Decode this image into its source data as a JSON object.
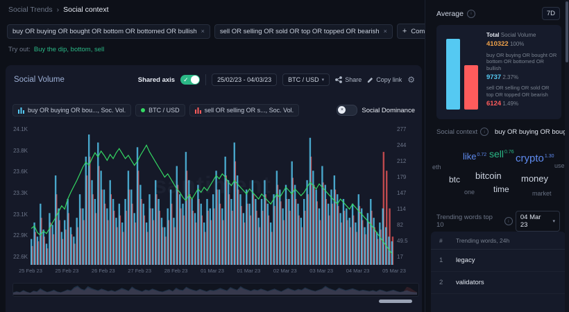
{
  "icons": {
    "info": "i",
    "close": "×",
    "check": "✓",
    "gear": "⚙",
    "chevron_down": "▾",
    "plus": "+"
  },
  "breadcrumb": {
    "parent": "Social Trends",
    "sep": "›",
    "current": "Social context"
  },
  "filters": {
    "chips": [
      {
        "label": "buy OR buying OR bought OR bottom OR bottomed OR bullish"
      },
      {
        "label": "sell OR selling OR sold OR top OR topped OR bearish"
      }
    ],
    "compare": "Compare",
    "try_out_prefix": "Try out:",
    "try_out_suggestions": "Buy the dip, bottom, sell"
  },
  "chart_panel": {
    "title": "Social Volume",
    "shared_axis": "Shared axis",
    "date_range": "25/02/23 - 04/03/23",
    "pair": "BTC / USD",
    "share": "Share",
    "copy_link": "Copy link",
    "social_dominance": "Social Dominance",
    "watermark": "santiment",
    "legend": [
      {
        "label": "buy OR buying OR bou..., Soc. Vol.",
        "color": "#55c9f2"
      },
      {
        "label": "BTC / USD",
        "color": "#34d863"
      },
      {
        "label": "sell OR selling OR s..., Soc. Vol.",
        "color": "#ff5c5c"
      }
    ]
  },
  "chart_data": {
    "type": "mixed",
    "title": "Social Volume",
    "x_labels": [
      "25 Feb 23",
      "25 Feb 23",
      "26 Feb 23",
      "27 Feb 23",
      "28 Feb 23",
      "01 Mar 23",
      "01 Mar 23",
      "02 Mar 23",
      "03 Mar 23",
      "04 Mar 23",
      "05 Mar 23"
    ],
    "left_axis": {
      "min": 22600,
      "max": 24100,
      "tick_labels": [
        "24.1K",
        "23.8K",
        "23.6K",
        "23.3K",
        "23.1K",
        "22.9K",
        "22.6K"
      ]
    },
    "right_axis": {
      "min": 0,
      "max": 277,
      "tick_labels": [
        "277",
        "244",
        "212",
        "179",
        "147",
        "114",
        "82",
        "49.5",
        "17"
      ]
    },
    "series": [
      {
        "name": "buy OR buying OR bought OR bottom OR bottomed OR bullish, Soc. Vol.",
        "type": "bar",
        "axis": "right",
        "color": "#55c9f2",
        "values": [
          55,
          90,
          60,
          130,
          75,
          45,
          110,
          85,
          190,
          120,
          70,
          95,
          140,
          80,
          60,
          100,
          150,
          120,
          230,
          277,
          180,
          140,
          260,
          200,
          160,
          120,
          180,
          140,
          100,
          130,
          90,
          140,
          200,
          160,
          110,
          250,
          170,
          130,
          90,
          150,
          120,
          180,
          140,
          100,
          80,
          120,
          160,
          100,
          210,
          150,
          130,
          240,
          180,
          140,
          110,
          170,
          130,
          90,
          140,
          120,
          150,
          200,
          160,
          120,
          230,
          180,
          140,
          260,
          190,
          150,
          110,
          160,
          130,
          180,
          140,
          100,
          140,
          180,
          130,
          90,
          150,
          200,
          160,
          120,
          170,
          140,
          220,
          170,
          130,
          100,
          140,
          180,
          270,
          200,
          160,
          120,
          210,
          170,
          130,
          160,
          190,
          150,
          110,
          140,
          120,
          100,
          130,
          90,
          150,
          120,
          80,
          110,
          140,
          100,
          70,
          90,
          120,
          80,
          60,
          50
        ]
      },
      {
        "name": "sell OR selling OR sold OR top OR topped OR bearish, Soc. Vol.",
        "type": "bar",
        "axis": "right",
        "color": "#ff5c5c",
        "values": [
          40,
          70,
          50,
          100,
          60,
          35,
          90,
          65,
          150,
          95,
          55,
          75,
          110,
          65,
          45,
          80,
          120,
          95,
          190,
          230,
          150,
          110,
          210,
          160,
          130,
          95,
          150,
          115,
          80,
          105,
          70,
          115,
          160,
          130,
          90,
          200,
          140,
          105,
          70,
          120,
          95,
          150,
          115,
          80,
          60,
          95,
          130,
          80,
          170,
          120,
          105,
          200,
          150,
          115,
          90,
          140,
          105,
          70,
          115,
          95,
          120,
          160,
          130,
          95,
          190,
          150,
          115,
          220,
          160,
          125,
          90,
          130,
          105,
          150,
          115,
          80,
          115,
          150,
          105,
          70,
          125,
          170,
          135,
          95,
          140,
          115,
          185,
          140,
          105,
          80,
          115,
          150,
          230,
          170,
          135,
          95,
          175,
          140,
          105,
          130,
          160,
          125,
          90,
          115,
          95,
          80,
          105,
          70,
          125,
          95,
          65,
          90,
          115,
          80,
          55,
          75,
          240,
          200,
          120,
          60
        ]
      },
      {
        "name": "BTC / USD",
        "type": "line",
        "axis": "left",
        "color": "#34d863",
        "values": [
          22950,
          22980,
          22900,
          22870,
          22920,
          22890,
          22950,
          23020,
          23080,
          23150,
          23220,
          23180,
          23300,
          23380,
          23450,
          23520,
          23600,
          23680,
          23740,
          23700,
          23780,
          23850,
          23800,
          23870,
          23820,
          23760,
          23830,
          23780,
          23850,
          23900,
          23840,
          23780,
          23820,
          23760,
          23700,
          23750,
          23820,
          23880,
          23940,
          23860,
          23800,
          23740,
          23680,
          23620,
          23560,
          23600,
          23540,
          23480,
          23420,
          23380,
          23320,
          23280,
          23350,
          23300,
          23360,
          23420,
          23380,
          23440,
          23400,
          23460,
          23520,
          23580,
          23540,
          23600,
          23560,
          23500,
          23460,
          23520,
          23480,
          23440,
          23400,
          23360,
          23420,
          23380,
          23340,
          23300,
          23360,
          23320,
          23280,
          23240,
          23300,
          23360,
          23320,
          23380,
          23440,
          23400,
          23360,
          23420,
          23380,
          23340,
          23380,
          23440,
          23500,
          23460,
          23420,
          23480,
          23440,
          23400,
          23360,
          23320,
          23280,
          23240,
          23300,
          23260,
          23220,
          23180,
          23240,
          23200,
          23160,
          23120,
          23080,
          23040,
          23000,
          22950,
          22900,
          22850,
          22800,
          22750,
          22700,
          22650
        ]
      }
    ]
  },
  "sidebar": {
    "average_label": "Average",
    "period": "7D",
    "summary": {
      "total_strong": "Total",
      "total_rest": "Social Volume",
      "total_value": "410322",
      "total_pct": "100%",
      "buy_query": "buy OR buying OR bought OR bottom OR bottomed OR bullish",
      "buy_value": "9737",
      "buy_pct": "2.37%",
      "sell_query": "sell OR selling OR sold OR top OR topped OR bearish",
      "sell_value": "6124",
      "sell_pct": "1.49%"
    },
    "social_context_label": "Social context",
    "social_context_selected": "buy OR buying OR bough",
    "word_cloud": [
      {
        "text": "like",
        "score": "0.72",
        "tone": "blue",
        "size": 13
      },
      {
        "text": "sell",
        "score": "0.76",
        "tone": "green",
        "size": 14
      },
      {
        "text": "crypto",
        "score": "1.30",
        "tone": "blue",
        "size": 15
      },
      {
        "text": "eth",
        "tone": "dim",
        "size": 9
      },
      {
        "text": "use",
        "tone": "dim",
        "size": 9
      },
      {
        "text": "btc",
        "tone": "light",
        "size": 12
      },
      {
        "text": "bitcoin",
        "tone": "light",
        "size": 13
      },
      {
        "text": "money",
        "tone": "light",
        "size": 13
      },
      {
        "text": "one",
        "tone": "dim",
        "size": 9
      },
      {
        "text": "time",
        "tone": "light",
        "size": 12
      },
      {
        "text": "market",
        "tone": "dim",
        "size": 9
      }
    ],
    "trending_label": "Trending words top 10",
    "trending_date": "04 Mar 23",
    "table": {
      "col_rank": "#",
      "col_words": "Trending words, 24h",
      "rows": [
        {
          "rank": "1",
          "word": "legacy"
        },
        {
          "rank": "2",
          "word": "validators"
        }
      ]
    }
  }
}
